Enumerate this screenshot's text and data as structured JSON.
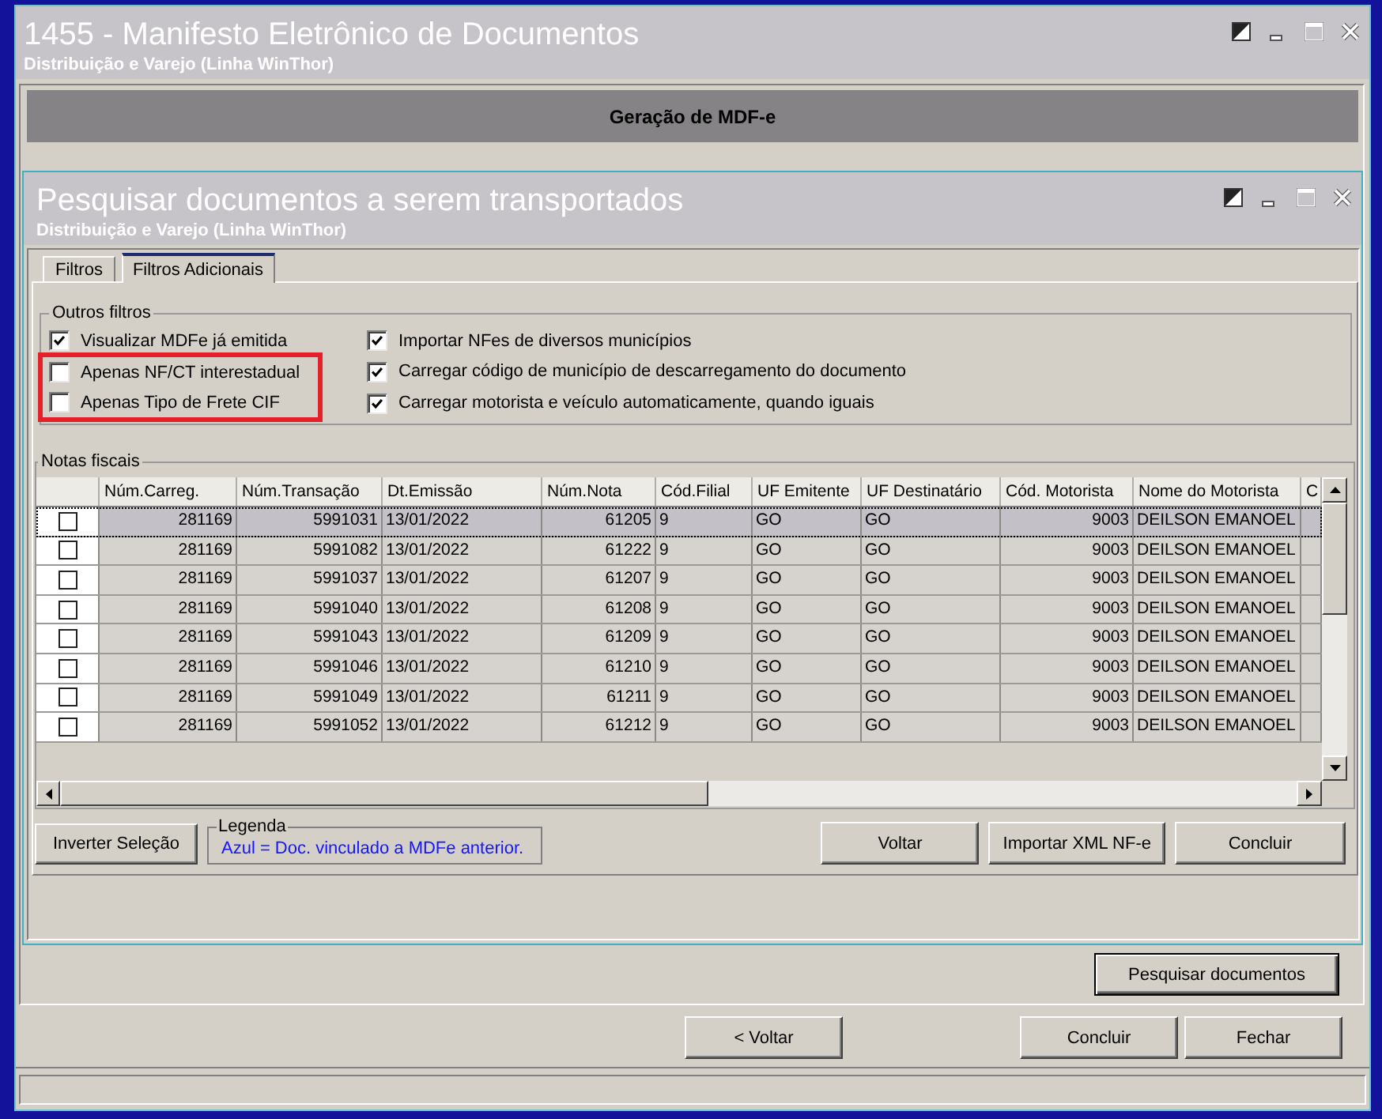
{
  "window": {
    "title": "1455 - Manifesto Eletrônico de Documentos",
    "subtitle": "Distribuição e Varejo (Linha WinThor)"
  },
  "panel": {
    "header": "Geração de MDF-e",
    "search_button": "Pesquisar documentos"
  },
  "footer": {
    "back_button": "< Voltar",
    "buttons": [
      "Concluir",
      "Fechar"
    ]
  },
  "dialog": {
    "title": "Pesquisar documentos a serem transportados",
    "subtitle": "Distribuição e Varejo (Linha WinThor)",
    "tabs": [
      {
        "label": "Filtros",
        "selected": false
      },
      {
        "label": "Filtros Adicionais",
        "selected": true
      }
    ],
    "other_filters": {
      "legend": "Outros filtros",
      "columns": [
        [
          {
            "label": "Visualizar MDFe já emitida",
            "checked": true,
            "highlighted": false
          },
          {
            "label": "Apenas NF/CT interestadual",
            "checked": false,
            "highlighted": true
          },
          {
            "label": "Apenas Tipo de Frete CIF",
            "checked": false,
            "highlighted": true
          }
        ],
        [
          {
            "label": "Importar NFes de diversos municípios",
            "checked": true,
            "highlighted": false
          },
          {
            "label": "Carregar código de município de descarregamento do documento",
            "checked": true,
            "highlighted": false
          },
          {
            "label": "Carregar motorista e veículo automaticamente, quando iguais",
            "checked": true,
            "highlighted": false
          }
        ]
      ]
    },
    "invoices": {
      "legend": "Notas fiscais",
      "columns": [
        {
          "label": "Núm.Carreg.",
          "kind": "number"
        },
        {
          "label": "Núm.Transação",
          "kind": "number"
        },
        {
          "label": "Dt.Emissão",
          "kind": "text"
        },
        {
          "label": "Núm.Nota",
          "kind": "number"
        },
        {
          "label": "Cód.Filial",
          "kind": "text"
        },
        {
          "label": "UF Emitente",
          "kind": "text"
        },
        {
          "label": "UF Destinatário",
          "kind": "text"
        },
        {
          "label": "Cód. Motorista",
          "kind": "number"
        },
        {
          "label": "Nome do Motorista",
          "kind": "text"
        },
        {
          "label": "C"
        }
      ],
      "rows": [
        {
          "selected": true,
          "checked": false,
          "cells": [
            "281169",
            "5991031",
            "13/01/2022",
            "61205",
            "9",
            "GO",
            "GO",
            "9003",
            "DEILSON EMANOEL"
          ]
        },
        {
          "selected": false,
          "checked": false,
          "cells": [
            "281169",
            "5991082",
            "13/01/2022",
            "61222",
            "9",
            "GO",
            "GO",
            "9003",
            "DEILSON EMANOEL"
          ]
        },
        {
          "selected": false,
          "checked": false,
          "cells": [
            "281169",
            "5991037",
            "13/01/2022",
            "61207",
            "9",
            "GO",
            "GO",
            "9003",
            "DEILSON EMANOEL"
          ]
        },
        {
          "selected": false,
          "checked": false,
          "cells": [
            "281169",
            "5991040",
            "13/01/2022",
            "61208",
            "9",
            "GO",
            "GO",
            "9003",
            "DEILSON EMANOEL"
          ]
        },
        {
          "selected": false,
          "checked": false,
          "cells": [
            "281169",
            "5991043",
            "13/01/2022",
            "61209",
            "9",
            "GO",
            "GO",
            "9003",
            "DEILSON EMANOEL"
          ]
        },
        {
          "selected": false,
          "checked": false,
          "cells": [
            "281169",
            "5991046",
            "13/01/2022",
            "61210",
            "9",
            "GO",
            "GO",
            "9003",
            "DEILSON EMANOEL"
          ]
        },
        {
          "selected": false,
          "checked": false,
          "cells": [
            "281169",
            "5991049",
            "13/01/2022",
            "61211",
            "9",
            "GO",
            "GO",
            "9003",
            "DEILSON EMANOEL"
          ]
        },
        {
          "selected": false,
          "checked": false,
          "cells": [
            "281169",
            "5991052",
            "13/01/2022",
            "61212",
            "9",
            "GO",
            "GO",
            "9003",
            "DEILSON EMANOEL"
          ]
        }
      ]
    },
    "invert_button": "Inverter Seleção",
    "legend_box": {
      "title": "Legenda",
      "text": "Azul = Doc. vinculado a MDFe anterior."
    },
    "buttons": [
      "Voltar",
      "Importar XML NF-e",
      "Concluir"
    ]
  }
}
